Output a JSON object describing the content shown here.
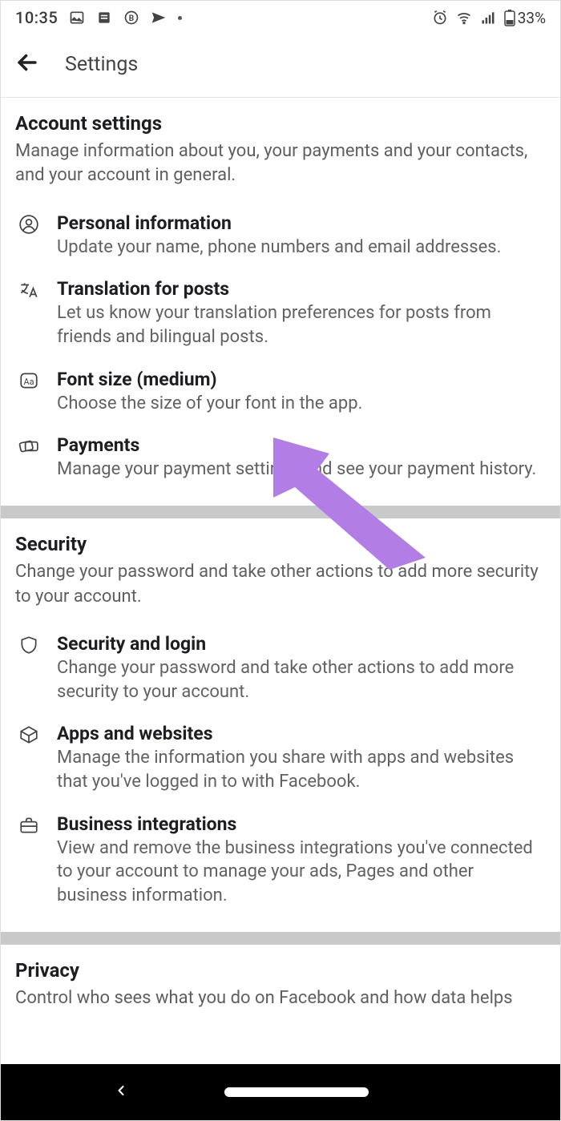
{
  "status": {
    "time": "10:35",
    "battery": "33%"
  },
  "header": {
    "title": "Settings"
  },
  "sections": [
    {
      "title": "Account settings",
      "desc": "Manage information about you, your payments and your contacts, and your account in general.",
      "items": [
        {
          "icon": "user-circle-icon",
          "title": "Personal information",
          "desc": "Update your name, phone numbers and email addresses."
        },
        {
          "icon": "translate-icon",
          "title": "Translation for posts",
          "desc": "Let us know your translation preferences for posts from friends and bilingual posts."
        },
        {
          "icon": "font-size-icon",
          "title": "Font size (medium)",
          "desc": "Choose the size of your font in the app."
        },
        {
          "icon": "payments-icon",
          "title": "Payments",
          "desc": "Manage your payment settings and see your payment history."
        }
      ]
    },
    {
      "title": "Security",
      "desc": "Change your password and take other actions to add more security to your account.",
      "items": [
        {
          "icon": "shield-icon",
          "title": "Security and login",
          "desc": "Change your password and take other actions to add more security to your account."
        },
        {
          "icon": "cube-icon",
          "title": "Apps and websites",
          "desc": "Manage the information you share with apps and websites that you've logged in to with Facebook."
        },
        {
          "icon": "briefcase-icon",
          "title": "Business integrations",
          "desc": "View and remove the business integrations you've connected to your account to manage your ads, Pages and other business information."
        }
      ]
    },
    {
      "title": "Privacy",
      "desc": "Control who sees what you do on Facebook and how data helps",
      "items": []
    }
  ]
}
